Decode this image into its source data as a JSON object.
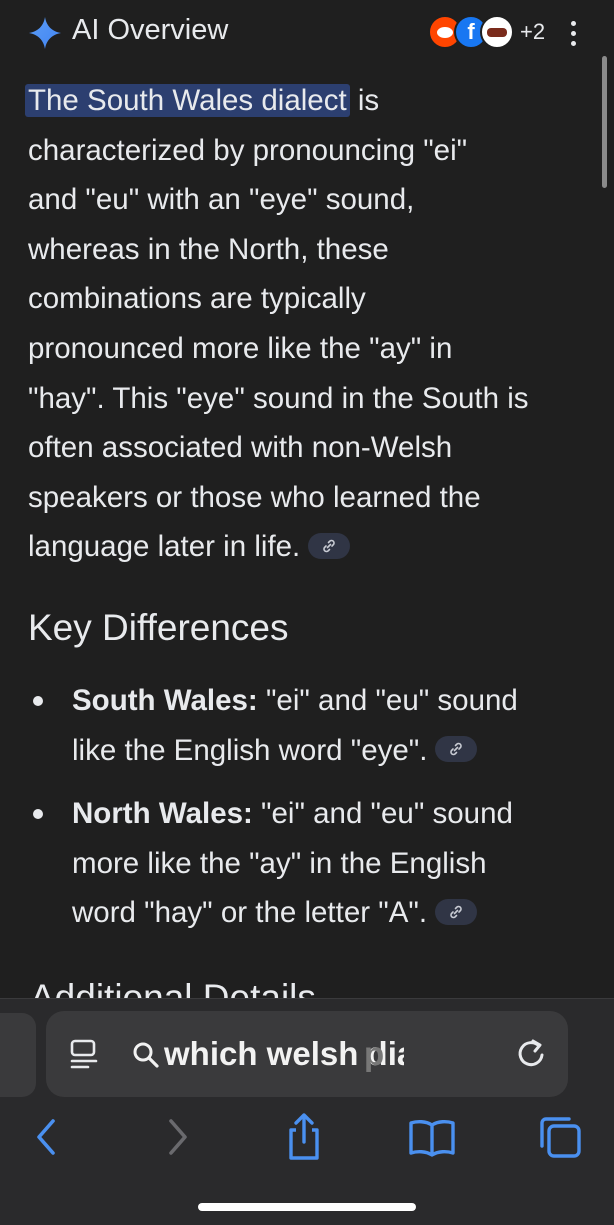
{
  "header": {
    "title": "AI Overview",
    "sources_more": "+2",
    "source_icons": [
      "reddit-icon",
      "facebook-icon",
      "site-icon"
    ]
  },
  "overview": {
    "highlight": "The South Wales dialect",
    "line1_rest": " is",
    "line2": "characterized by pronouncing \"ei\"",
    "line3": "and \"eu\" with an \"eye\" sound,",
    "line4": "whereas in the North, these",
    "line5": "combinations are typically",
    "line6": "pronounced more like the \"ay\" in",
    "line7": "\"hay\". This \"eye\" sound in the South is",
    "line8": "often associated with non-Welsh",
    "line9": "speakers or those who learned the",
    "line10": "language later in life."
  },
  "key_differences": {
    "heading": "Key Differences",
    "items": [
      {
        "term": "South Wales:",
        "line1": " \"ei\" and \"eu\" sound",
        "line2": "like the English word \"eye\"."
      },
      {
        "term": "North Wales:",
        "line1": " \"ei\" and \"eu\" sound",
        "line2": "more like the \"ay\" in the English",
        "line3": "word \"hay\" or the letter \"A\"."
      }
    ]
  },
  "next_heading": "Additional Details",
  "browser": {
    "url_text": "which welsh dialect",
    "url_fade": "p"
  },
  "colors": {
    "background": "#1f1f1f",
    "highlight": "#2c3f70",
    "accent_blue": "#5b9cf5",
    "chrome": "#2a2a2c"
  }
}
